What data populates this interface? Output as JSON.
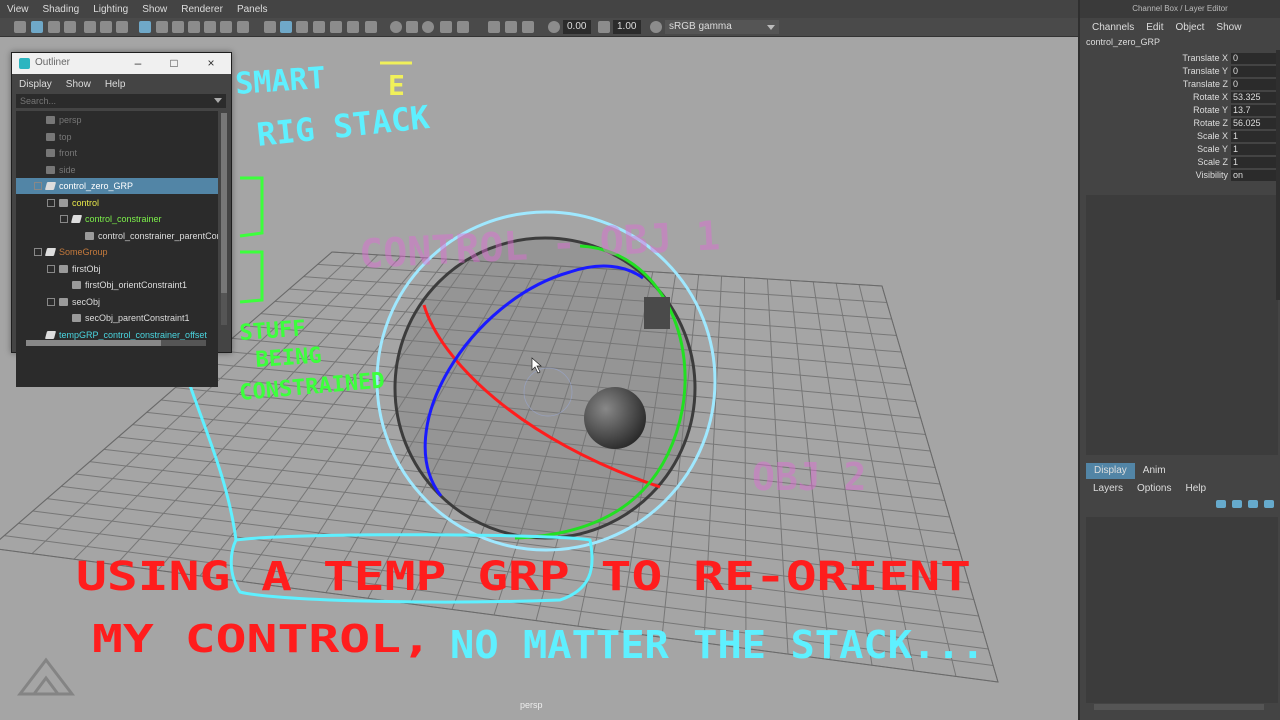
{
  "viewport": {
    "menus": [
      "View",
      "Shading",
      "Lighting",
      "Show",
      "Renderer",
      "Panels"
    ],
    "toolbar": {
      "field1": "0.00",
      "field2": "1.00",
      "colorspace": "sRGB gamma"
    },
    "camera_label": "persp"
  },
  "annotations": {
    "smart": "SMART",
    "ampersand": "E",
    "rig_stack": "RIG STACK",
    "control_obj1": "CONTROL - OBJ 1",
    "obj2": "OBJ 2",
    "stuff": "STUFF",
    "being": "BEING",
    "constrained": "CONSTRAINED",
    "line1": "USING A TEMP GRP TO RE-ORIENT",
    "line2_red": "MY CONTROL,",
    "line2_cyan": "NO MATTER THE STACK..."
  },
  "outliner": {
    "title": "Outliner",
    "menus": [
      "Display",
      "Show",
      "Help"
    ],
    "search_placeholder": "Search...",
    "items": [
      {
        "label": "persp",
        "indent": 1,
        "color": "#777777",
        "icon": "camera-icon"
      },
      {
        "label": "top",
        "indent": 1,
        "color": "#777777",
        "icon": "camera-icon"
      },
      {
        "label": "front",
        "indent": 1,
        "color": "#777777",
        "icon": "camera-icon"
      },
      {
        "label": "side",
        "indent": 1,
        "color": "#777777",
        "icon": "camera-icon"
      },
      {
        "label": "control_zero_GRP",
        "indent": 1,
        "color": "#ffffff",
        "icon": "transform-icon",
        "selected": true,
        "expander": "-"
      },
      {
        "label": "control",
        "indent": 2,
        "color": "#e8e84a",
        "icon": "curve-icon",
        "expander": "-"
      },
      {
        "label": "control_constrainer",
        "indent": 3,
        "color": "#7cf04a",
        "icon": "transform-icon",
        "expander": "-"
      },
      {
        "label": "control_constrainer_parentConstraint1",
        "indent": 4,
        "color": "#dddddd",
        "icon": "constraint-icon"
      },
      {
        "label": "SomeGroup",
        "indent": 1,
        "color": "#c57a3c",
        "icon": "transform-icon",
        "expander": "-"
      },
      {
        "label": "firstObj",
        "indent": 2,
        "color": "#dddddd",
        "icon": "mesh-icon",
        "expander": "-"
      },
      {
        "label": "firstObj_orientConstraint1",
        "indent": 3,
        "color": "#dddddd",
        "icon": "constraint-icon"
      },
      {
        "label": "secObj",
        "indent": 2,
        "color": "#dddddd",
        "icon": "mesh-icon",
        "expander": "-"
      },
      {
        "label": "secObj_parentConstraint1",
        "indent": 3,
        "color": "#dddddd",
        "icon": "constraint-icon"
      },
      {
        "label": "tempGRP_control_constrainer_offset",
        "indent": 1,
        "color": "#4ad6e0",
        "icon": "transform-icon"
      }
    ]
  },
  "channelbox": {
    "title": "Channel Box / Layer Editor",
    "menus": [
      "Channels",
      "Edit",
      "Object",
      "Show"
    ],
    "object_name": "control_zero_GRP",
    "attributes": [
      {
        "name": "Translate X",
        "value": "0"
      },
      {
        "name": "Translate Y",
        "value": "0"
      },
      {
        "name": "Translate Z",
        "value": "0"
      },
      {
        "name": "Rotate X",
        "value": "53.325"
      },
      {
        "name": "Rotate Y",
        "value": "13.7"
      },
      {
        "name": "Rotate Z",
        "value": "56.025"
      },
      {
        "name": "Scale X",
        "value": "1"
      },
      {
        "name": "Scale Y",
        "value": "1"
      },
      {
        "name": "Scale Z",
        "value": "1"
      },
      {
        "name": "Visibility",
        "value": "on"
      }
    ],
    "layer_tabs": [
      "Display",
      "Anim"
    ],
    "layer_menus": [
      "Layers",
      "Options",
      "Help"
    ]
  }
}
